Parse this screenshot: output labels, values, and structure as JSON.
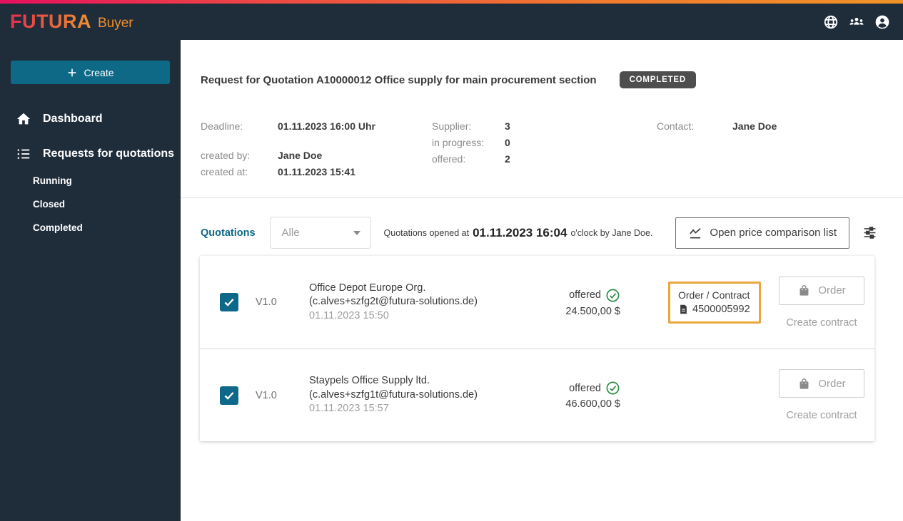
{
  "header": {
    "logo": "FUTURA",
    "logo_suffix": "Buyer",
    "icons": [
      "globe",
      "user-group",
      "account-circle"
    ]
  },
  "sidebar": {
    "create_label": "Create",
    "items": [
      {
        "label": "Dashboard"
      },
      {
        "label": "Requests for quotations"
      }
    ],
    "subitems": [
      {
        "label": "Running"
      },
      {
        "label": "Closed"
      },
      {
        "label": "Completed"
      }
    ]
  },
  "page": {
    "title": "Request for Quotation A10000012 Office supply for main procurement section",
    "status_badge": "COMPLETED",
    "details": {
      "deadline_label": "Deadline:",
      "deadline_value": "01.11.2023 16:00 Uhr",
      "created_by_label": "created by:",
      "created_by_value": "Jane Doe",
      "created_at_label": "created at:",
      "created_at_value": "01.11.2023 15:41",
      "supplier_label": "Supplier:",
      "supplier_value": "3",
      "in_progress_label": "in progress:",
      "in_progress_value": "0",
      "offered_label": "offered:",
      "offered_value": "2",
      "contact_label": "Contact:",
      "contact_value": "Jane Doe"
    }
  },
  "quotations": {
    "section_label": "Quotations",
    "filter_value": "Alle",
    "opened_prefix": "Quotations opened at",
    "opened_datetime": "01.11.2023 16:04",
    "opened_suffix": "o'clock by Jane Doe.",
    "price_comparison_label": "Open price comparison list",
    "rows": [
      {
        "version": "V1.0",
        "supplier": "Office Depot Europe Org.",
        "email": "(c.alves+szfg2t@futura-solutions.de)",
        "date": "01.11.2023 15:50",
        "status": "offered",
        "amount": "24.500,00 $",
        "order_contract_label": "Order / Contract",
        "order_contract_number": "4500005992",
        "order_label": "Order",
        "create_contract_label": "Create contract"
      },
      {
        "version": "V1.0",
        "supplier": "Staypels Office Supply ltd.",
        "email": "(c.alves+szfg1t@futura-solutions.de)",
        "date": "01.11.2023 15:57",
        "status": "offered",
        "amount": "46.600,00 $",
        "order_label": "Order",
        "create_contract_label": "Create contract"
      }
    ]
  },
  "colors": {
    "header_bg": "#1f2d3b",
    "accent_teal": "#0e6987",
    "brand_gradient_start": "#e6105e",
    "brand_gradient_end": "#ef9327",
    "badge_bg": "#4e4e4e",
    "offered_green": "#2e8b44",
    "highlight_orange": "#eaa63c"
  }
}
